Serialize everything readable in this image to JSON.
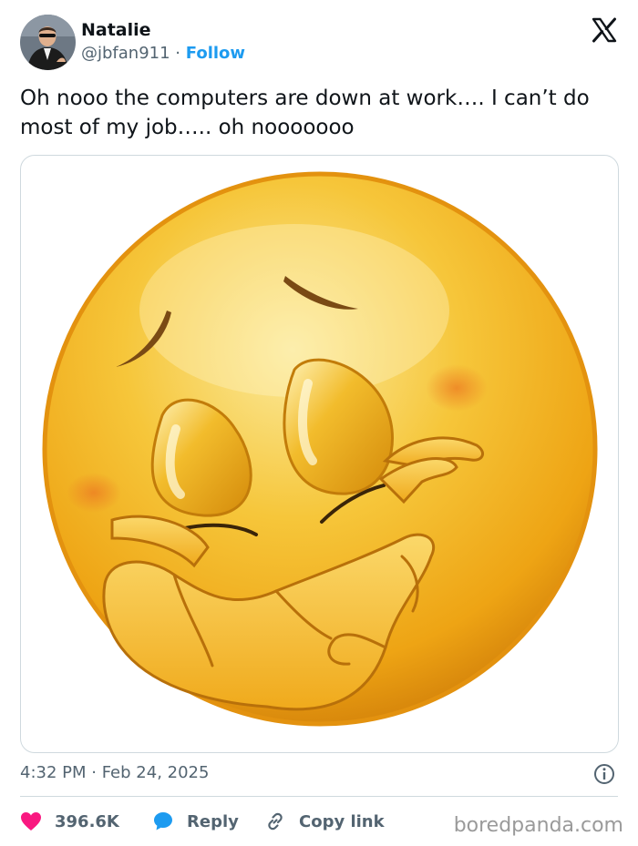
{
  "author": {
    "name": "Natalie",
    "handle": "@jbfan911",
    "separator": "·",
    "follow_label": "Follow"
  },
  "tweet": {
    "text": "Oh nooo the computers are down at work…. I can’t do most of my job….. oh nooooooo",
    "time": "4:32 PM · Feb 24, 2025"
  },
  "actions": {
    "likes": "396.6K",
    "reply_label": "Reply",
    "copy_label": "Copy link"
  },
  "watermark": "boredpanda.com",
  "colors": {
    "accent": "#1d9bf0",
    "like": "#f91880",
    "text_primary": "#0f1419",
    "text_secondary": "#536471",
    "border": "#cfd9de"
  },
  "icons": {
    "brand": "x-logo-icon",
    "like": "heart-icon",
    "reply": "speech-bubble-icon",
    "copy": "link-icon",
    "info": "info-icon"
  }
}
